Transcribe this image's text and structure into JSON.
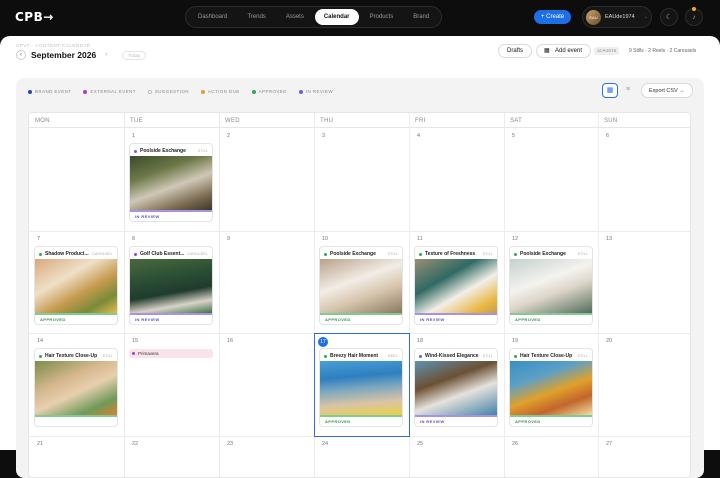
{
  "app": {
    "logo": "CPB→"
  },
  "nav": {
    "items": [
      "Dashboard",
      "Trends",
      "Assets",
      "Calendar",
      "Products",
      "Brand"
    ],
    "active": "Calendar"
  },
  "header": {
    "create_label": "+ Create",
    "user_initials": "EAU",
    "user_name": "EAUde1974",
    "theme_icon": "moon-icon",
    "notifications_icon": "bell-icon"
  },
  "toolbar": {
    "breadcrumb": "CPV7 · CONTENT CALENDAR",
    "month": "September 2026",
    "today_label": "Today",
    "drafts_label": "Drafts",
    "add_event_label": "Add event",
    "posts_count": "12 POSTS",
    "stats": "9 Stills · 2 Reels · 2 Carousels"
  },
  "legend": [
    {
      "label": "BRAND EVENT",
      "color": "#1e4bb0"
    },
    {
      "label": "EXTERNAL EVENT",
      "color": "#a142c8"
    },
    {
      "label": "SUGGESTION",
      "color": "#ffffff"
    },
    {
      "label": "ACTION DUE",
      "color": "#f09a2a"
    },
    {
      "label": "APPROVED",
      "color": "#2fa84f"
    },
    {
      "label": "IN REVIEW",
      "color": "#7e57e0"
    }
  ],
  "view": {
    "export_label": "Export CSV →"
  },
  "weekdays": [
    "MON",
    "TUE",
    "WED",
    "THU",
    "FRI",
    "SAT",
    "SUN"
  ],
  "weeks": [
    [
      "",
      "1",
      "2",
      "3",
      "4",
      "5",
      "6"
    ],
    [
      "7",
      "8",
      "9",
      "10",
      "11",
      "12",
      "13"
    ],
    [
      "14",
      "15",
      "16",
      "17",
      "18",
      "19",
      "20"
    ],
    [
      "21",
      "22",
      "23",
      "24",
      "25",
      "26",
      "27"
    ]
  ],
  "today_day": "17",
  "posts": [
    {
      "title": "Poolside Exchange",
      "type": "STILL",
      "status": "IN REVIEW",
      "dot": "#7e57e0",
      "status_color": "#5b4bb5",
      "bar": "#a792e6",
      "img": "linear-gradient(160deg,#3b4a2c 0%,#6c7848 30%,#cfc8b6 55%,#7a6a50 80%,#3a3428 100%)"
    },
    {
      "title": "Shadow Product...",
      "type": "CAROUSEL",
      "status": "APPROVED",
      "dot": "#2fa84f",
      "status_color": "#2f8f4a",
      "bar": "#7fcb93",
      "img": "linear-gradient(150deg,#d9a87c 0%,#efe0c8 35%,#c59a4e 60%,#7a8a3a 80%,#e8c24a 100%)"
    },
    {
      "title": "Golf Club Essent...",
      "type": "CAROUSEL",
      "status": "IN REVIEW",
      "dot": "#a142c8",
      "status_color": "#5b4bb5",
      "bar": "#a792e6",
      "img": "linear-gradient(170deg,#4a6a3a 0%,#2b4f35 35%,#1f3b2c 60%,#d9d3c8 80%,#3a6f45 100%)"
    },
    {
      "title": "Poolside Exchange",
      "type": "STILL",
      "status": "APPROVED",
      "dot": "#2fa84f",
      "status_color": "#2f8f4a",
      "bar": "#7fcb93",
      "img": "linear-gradient(160deg,#b9a18a 0%,#f2ede6 40%,#d6c4ad 65%,#8a7660 100%)"
    },
    {
      "title": "Texture of Freshness",
      "type": "STILL",
      "status": "IN REVIEW",
      "dot": "#2fa84f",
      "status_color": "#5b4bb5",
      "bar": "#a792e6",
      "img": "linear-gradient(150deg,#9a8e74 0%,#2f6a63 35%,#f1efe9 60%,#e8b63e 85%,#c49b52 100%)"
    },
    {
      "title": "Poolside Exchange",
      "type": "STILL",
      "status": "APPROVED",
      "dot": "#2fa84f",
      "status_color": "#2f8f4a",
      "bar": "#7fcb93",
      "img": "linear-gradient(160deg,#c4d0cc 0%,#f4f3ef 40%,#dcd5c8 60%,#4f6a58 100%)"
    },
    {
      "title": "Hair Texture Close-Up",
      "type": "STILL",
      "status": "",
      "dot": "#2fa84f",
      "status_color": "#2f8f4a",
      "bar": "#7fcb93",
      "img": "linear-gradient(155deg,#7a8c4a 0%,#d6b78e 35%,#e8cfae 55%,#6f9a5a 80%,#e07e2a 100%)"
    },
    {
      "title": "Breezy Hair Moment",
      "type": "REEL",
      "status": "APPROVED",
      "dot": "#2fa84f",
      "status_color": "#2f8f4a",
      "bar": "#7fcb93",
      "img": "linear-gradient(175deg,#4a9fd3 0%,#2e7fc0 30%,#7aa7c0 50%,#d9c4a4 75%,#e9d04a 100%)"
    },
    {
      "title": "Wind-Kissed Elegance",
      "type": "STILL",
      "status": "IN REVIEW",
      "dot": "#7e57e0",
      "status_color": "#5b4bb5",
      "bar": "#a792e6",
      "img": "linear-gradient(160deg,#5f92b3 0%,#6b5034 35%,#e6e2dc 60%,#3f7fa8 100%)"
    },
    {
      "title": "Hair Texture Close-Up",
      "type": "STILL",
      "status": "APPROVED",
      "dot": "#2fa84f",
      "status_color": "#2f8f4a",
      "bar": "#7fcb93",
      "img": "linear-gradient(160deg,#3a8ec0 0%,#5aa0c8 30%,#e0a12a 55%,#c2652c 75%,#f1e3a4 100%)"
    }
  ],
  "events": [
    {
      "label": "Primavera"
    }
  ]
}
